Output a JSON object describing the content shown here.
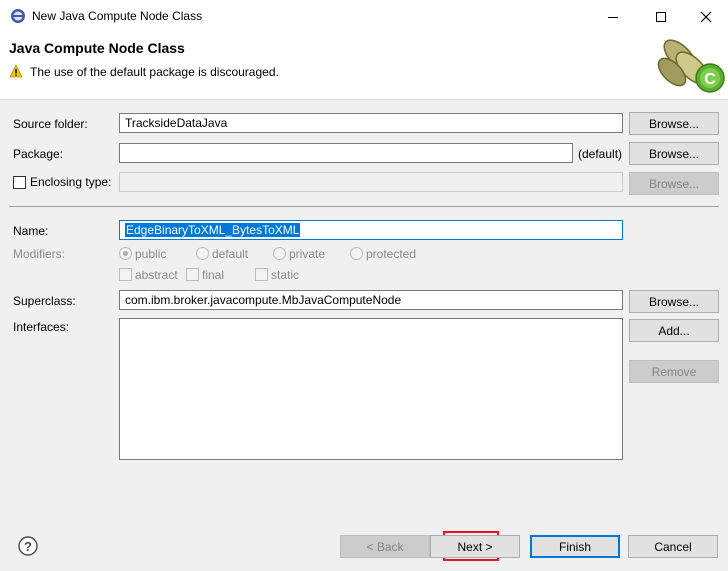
{
  "window": {
    "title": "New Java Compute Node Class"
  },
  "banner": {
    "title": "Java Compute Node Class",
    "message": "The use of the default package is discouraged."
  },
  "form": {
    "source_folder": {
      "label": "Source folder:",
      "value": "TracksideDataJava",
      "button": "Browse..."
    },
    "package": {
      "label": "Package:",
      "value": "",
      "suffix": "(default)",
      "button": "Browse..."
    },
    "enclosing_type": {
      "label": "Enclosing type:",
      "value": "",
      "button": "Browse..."
    },
    "name": {
      "label": "Name:",
      "value": "EdgeBinaryToXML_BytesToXML"
    },
    "modifiers": {
      "label": "Modifiers:",
      "access": [
        "public",
        "default",
        "private",
        "protected"
      ],
      "selected_access": "public",
      "flags": [
        "abstract",
        "final",
        "static"
      ]
    },
    "superclass": {
      "label": "Superclass:",
      "value": "com.ibm.broker.javacompute.MbJavaComputeNode",
      "button": "Browse..."
    },
    "interfaces": {
      "label": "Interfaces:",
      "add_button": "Add...",
      "remove_button": "Remove",
      "items": []
    }
  },
  "footer": {
    "help_icon": "help-icon",
    "back": "< Back",
    "next": "Next >",
    "finish": "Finish",
    "cancel": "Cancel"
  },
  "colors": {
    "accent": "#0078d7",
    "highlight": "#e81123",
    "warning": "#f2c40f"
  }
}
